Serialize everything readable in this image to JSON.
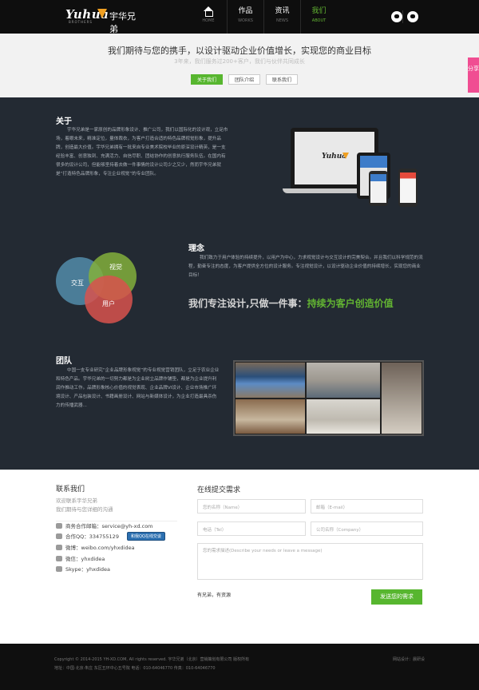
{
  "header": {
    "logo_script": "Yuhua",
    "logo_sub": "BROTHERS",
    "logo_cn": "宇华兄弟",
    "nav": [
      {
        "title": "",
        "sub": "HOME",
        "icon": "home-icon"
      },
      {
        "title": "作品",
        "sub": "WORKS"
      },
      {
        "title": "资讯",
        "sub": "NEWS"
      },
      {
        "title": "我们",
        "sub": "ABOUT",
        "active": true
      }
    ],
    "icons": [
      "wechat-icon",
      "user-icon"
    ]
  },
  "intro": {
    "headline": "我们期待与您的携手，以设计驱动企业价值增长，实现您的商业目标",
    "subline": "3年来，我们服务过200+客户，我们与伙伴共同成长",
    "tabs": [
      {
        "label": "关于我们",
        "active": true
      },
      {
        "label": "团队介绍"
      },
      {
        "label": "联系我们"
      }
    ]
  },
  "share": {
    "label": "分享"
  },
  "about": {
    "title": "关于",
    "text": "宇华兄弟是一家原创的品牌形象设计、推广公司，我们以国际化的设计观，立足市场，着眼未来，精准定位，量体裁衣，为客户打造合适的特色品牌视觉形象，提升品牌，创造最大价值。宇华兄弟拥有一批来自专业美术院校毕业的原深设计精英，是一支经验丰富、创意独到、充满活力、自信尽职、团结协作的创意执行服务队伍。在国内有很多的设计公司，但能够坚持着去做一件事情的设计公司少之又少，然而宇华兄弟就是“打造特色品牌形象，专注企业视觉”的专业团队。"
  },
  "concept": {
    "title": "理念",
    "text": "我们致力于用户体验的持续提升，以用户为中心，力求视觉设计与交互设计的完美契合。并且我们以科学规范的流程，勤奋专注的态度，为客户提供全方位的设计服务。专注视觉设计，以设计驱动企业价值的持续增长，实现您的商业目标！",
    "venn": [
      "交互",
      "视觉",
      "用户"
    ],
    "slogan_prefix": "我们专注设计,只做一件事：",
    "slogan_highlight": "持续为客户创造价值"
  },
  "team": {
    "title": "团队",
    "text": "中国一支专业研究“企业品牌形象视觉”的专业视觉营销团队，立足于农业企业和特色产品。宇华兄弟的一切努力都是为企业树立品牌作铺垫，都是为企业提升利润作推动工作。品牌形象核心价值的视觉表现、企业品牌VI设计、企业市场推广环境设计、产品包装设计、书籍画册设计、网站与新媒体设计，为企业打造最具杀伤力的传播武器..."
  },
  "contact": {
    "title": "联系我们",
    "sub1": "欢迎联系宇华兄弟",
    "sub2": "我们期待与您详细的沟通",
    "lines": [
      {
        "icon": "mail-icon",
        "text": "商务合作邮箱：service@yh-xd.com"
      },
      {
        "icon": "qq-icon",
        "text": "合作QQ：334755129",
        "badge": "和我QQ在线交谈"
      },
      {
        "icon": "weibo-icon",
        "text": "微博：weibo.com/yhxdidea"
      },
      {
        "icon": "wechat-icon",
        "text": "微信：yhxdidea"
      },
      {
        "icon": "skype-icon",
        "text": "Skype：yhxdidea"
      }
    ]
  },
  "form": {
    "title": "在线提交需求",
    "name_placeholder": "您的名称（Name）",
    "email_placeholder": "邮箱（E-mail）",
    "tel_placeholder": "电话（Tel）",
    "company_placeholder": "公司名称（Company）",
    "message_placeholder": "您的需求描述(Describe your needs or leave a message)",
    "note": "有兄弟，有资源",
    "submit_label": "发送您的需求"
  },
  "footer": {
    "copyright": "Copyright © 2014-2015 YH-XD.COM, All rights reserved. 宇华兄弟（北京）营销策划有限公司 版权所有",
    "address": "地址：中国·北京·朱庄 东区五环中心五号院 电话：010-64046770 传真：010-64046770",
    "links": "网站设计：晨研设"
  }
}
